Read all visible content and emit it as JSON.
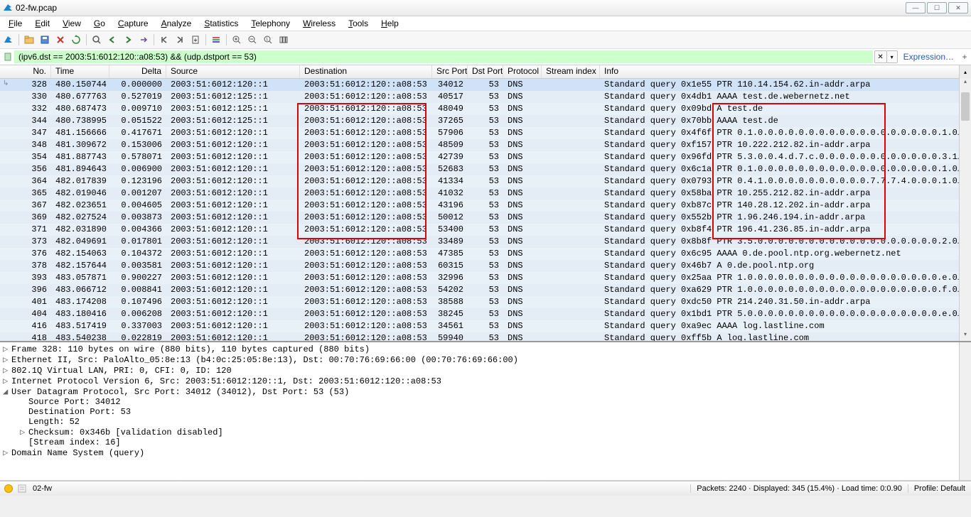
{
  "window": {
    "title": "02-fw.pcap"
  },
  "menu": [
    "File",
    "Edit",
    "View",
    "Go",
    "Capture",
    "Analyze",
    "Statistics",
    "Telephony",
    "Wireless",
    "Tools",
    "Help"
  ],
  "filter": {
    "value": "(ipv6.dst == 2003:51:6012:120::a08:53) && (udp.dstport == 53)",
    "expression_label": "Expression…",
    "plus": "+"
  },
  "columns": [
    "No.",
    "Time",
    "Delta",
    "Source",
    "Destination",
    "Src Port",
    "Dst Port",
    "Protocol",
    "Stream index",
    "Info"
  ],
  "rows": [
    {
      "no": "328",
      "time": "480.150744",
      "delta": "0.000000",
      "src": "2003:51:6012:120::1",
      "dst": "2003:51:6012:120::a08:53",
      "sp": "34012",
      "dp": "53",
      "proto": "DNS",
      "info": "Standard query 0x1e55 PTR 110.14.154.62.in-addr.arpa",
      "sel": true
    },
    {
      "no": "330",
      "time": "480.677763",
      "delta": "0.527019",
      "src": "2003:51:6012:125::1",
      "dst": "2003:51:6012:120::a08:53",
      "sp": "40517",
      "dp": "53",
      "proto": "DNS",
      "info": "Standard query 0x4db1 AAAA test.de.webernetz.net"
    },
    {
      "no": "332",
      "time": "480.687473",
      "delta": "0.009710",
      "src": "2003:51:6012:125::1",
      "dst": "2003:51:6012:120::a08:53",
      "sp": "48049",
      "dp": "53",
      "proto": "DNS",
      "info": "Standard query 0x09bd A test.de"
    },
    {
      "no": "344",
      "time": "480.738995",
      "delta": "0.051522",
      "src": "2003:51:6012:125::1",
      "dst": "2003:51:6012:120::a08:53",
      "sp": "37265",
      "dp": "53",
      "proto": "DNS",
      "info": "Standard query 0x70bb AAAA test.de"
    },
    {
      "no": "347",
      "time": "481.156666",
      "delta": "0.417671",
      "src": "2003:51:6012:120::1",
      "dst": "2003:51:6012:120::a08:53",
      "sp": "57906",
      "dp": "53",
      "proto": "DNS",
      "info": "Standard query 0x4f6f PTR 0.1.0.0.0.0.0.0.0.0.0.0.0.0.0.0.0.0.0.0.1.0…"
    },
    {
      "no": "348",
      "time": "481.309672",
      "delta": "0.153006",
      "src": "2003:51:6012:120::1",
      "dst": "2003:51:6012:120::a08:53",
      "sp": "48509",
      "dp": "53",
      "proto": "DNS",
      "info": "Standard query 0xf157 PTR 10.222.212.82.in-addr.arpa"
    },
    {
      "no": "354",
      "time": "481.887743",
      "delta": "0.578071",
      "src": "2003:51:6012:120::1",
      "dst": "2003:51:6012:120::a08:53",
      "sp": "42739",
      "dp": "53",
      "proto": "DNS",
      "info": "Standard query 0x96fd PTR 5.3.0.0.4.d.7.c.0.0.0.0.0.0.0.0.0.0.0.0.3.1…"
    },
    {
      "no": "356",
      "time": "481.894643",
      "delta": "0.006900",
      "src": "2003:51:6012:120::1",
      "dst": "2003:51:6012:120::a08:53",
      "sp": "52683",
      "dp": "53",
      "proto": "DNS",
      "info": "Standard query 0x6c1a PTR 0.1.0.0.0.0.0.0.0.0.0.0.0.0.0.0.0.0.0.0.1.0…"
    },
    {
      "no": "364",
      "time": "482.017839",
      "delta": "0.123196",
      "src": "2003:51:6012:120::1",
      "dst": "2003:51:6012:120::a08:53",
      "sp": "41334",
      "dp": "53",
      "proto": "DNS",
      "info": "Standard query 0x0793 PTR 0.4.1.0.0.0.0.0.0.0.0.0.0.7.7.7.4.0.0.0.1.0…"
    },
    {
      "no": "365",
      "time": "482.019046",
      "delta": "0.001207",
      "src": "2003:51:6012:120::1",
      "dst": "2003:51:6012:120::a08:53",
      "sp": "41032",
      "dp": "53",
      "proto": "DNS",
      "info": "Standard query 0x58ba PTR 10.255.212.82.in-addr.arpa"
    },
    {
      "no": "367",
      "time": "482.023651",
      "delta": "0.004605",
      "src": "2003:51:6012:120::1",
      "dst": "2003:51:6012:120::a08:53",
      "sp": "43196",
      "dp": "53",
      "proto": "DNS",
      "info": "Standard query 0xb87c PTR 140.28.12.202.in-addr.arpa"
    },
    {
      "no": "369",
      "time": "482.027524",
      "delta": "0.003873",
      "src": "2003:51:6012:120::1",
      "dst": "2003:51:6012:120::a08:53",
      "sp": "50012",
      "dp": "53",
      "proto": "DNS",
      "info": "Standard query 0x552b PTR 1.96.246.194.in-addr.arpa"
    },
    {
      "no": "371",
      "time": "482.031890",
      "delta": "0.004366",
      "src": "2003:51:6012:120::1",
      "dst": "2003:51:6012:120::a08:53",
      "sp": "53400",
      "dp": "53",
      "proto": "DNS",
      "info": "Standard query 0xb8f4 PTR 196.41.236.85.in-addr.arpa"
    },
    {
      "no": "373",
      "time": "482.049691",
      "delta": "0.017801",
      "src": "2003:51:6012:120::1",
      "dst": "2003:51:6012:120::a08:53",
      "sp": "33489",
      "dp": "53",
      "proto": "DNS",
      "info": "Standard query 0x8b8f PTR 3.5.0.0.0.0.0.0.0.0.0.0.0.0.0.0.0.0.0.0.2.0…"
    },
    {
      "no": "376",
      "time": "482.154063",
      "delta": "0.104372",
      "src": "2003:51:6012:120::1",
      "dst": "2003:51:6012:120::a08:53",
      "sp": "47385",
      "dp": "53",
      "proto": "DNS",
      "info": "Standard query 0x6c95 AAAA 0.de.pool.ntp.org.webernetz.net"
    },
    {
      "no": "378",
      "time": "482.157644",
      "delta": "0.003581",
      "src": "2003:51:6012:120::1",
      "dst": "2003:51:6012:120::a08:53",
      "sp": "60315",
      "dp": "53",
      "proto": "DNS",
      "info": "Standard query 0x46b7 A 0.de.pool.ntp.org"
    },
    {
      "no": "393",
      "time": "483.057871",
      "delta": "0.900227",
      "src": "2003:51:6012:120::1",
      "dst": "2003:51:6012:120::a08:53",
      "sp": "32996",
      "dp": "53",
      "proto": "DNS",
      "info": "Standard query 0x25aa PTR 1.0.0.0.0.0.0.0.0.0.0.0.0.0.0.0.0.0.0.0.e.0…"
    },
    {
      "no": "396",
      "time": "483.066712",
      "delta": "0.008841",
      "src": "2003:51:6012:120::1",
      "dst": "2003:51:6012:120::a08:53",
      "sp": "54202",
      "dp": "53",
      "proto": "DNS",
      "info": "Standard query 0xa629 PTR 1.0.0.0.0.0.0.0.0.0.0.0.0.0.0.0.0.0.0.0.f.0…"
    },
    {
      "no": "401",
      "time": "483.174208",
      "delta": "0.107496",
      "src": "2003:51:6012:120::1",
      "dst": "2003:51:6012:120::a08:53",
      "sp": "38588",
      "dp": "53",
      "proto": "DNS",
      "info": "Standard query 0xdc50 PTR 214.240.31.50.in-addr.arpa"
    },
    {
      "no": "404",
      "time": "483.180416",
      "delta": "0.006208",
      "src": "2003:51:6012:120::1",
      "dst": "2003:51:6012:120::a08:53",
      "sp": "38245",
      "dp": "53",
      "proto": "DNS",
      "info": "Standard query 0x1bd1 PTR 5.0.0.0.0.0.0.0.0.0.0.0.0.0.0.0.0.0.0.0.e.0…"
    },
    {
      "no": "416",
      "time": "483.517419",
      "delta": "0.337003",
      "src": "2003:51:6012:120::1",
      "dst": "2003:51:6012:120::a08:53",
      "sp": "34561",
      "dp": "53",
      "proto": "DNS",
      "info": "Standard query 0xa9ec AAAA log.lastline.com"
    },
    {
      "no": "418",
      "time": "483.540238",
      "delta": "0.022819",
      "src": "2003:51:6012:120::1",
      "dst": "2003:51:6012:120::a08:53",
      "sp": "59940",
      "dp": "53",
      "proto": "DNS",
      "info": "Standard query 0xff5b A log.lastline.com"
    }
  ],
  "details": [
    {
      "tri": "▷",
      "ind": 0,
      "text": "Frame 328: 110 bytes on wire (880 bits), 110 bytes captured (880 bits)"
    },
    {
      "tri": "▷",
      "ind": 0,
      "text": "Ethernet II, Src: PaloAlto_05:8e:13 (b4:0c:25:05:8e:13), Dst: 00:70:76:69:66:00 (00:70:76:69:66:00)"
    },
    {
      "tri": "▷",
      "ind": 0,
      "text": "802.1Q Virtual LAN, PRI: 0, CFI: 0, ID: 120"
    },
    {
      "tri": "▷",
      "ind": 0,
      "text": "Internet Protocol Version 6, Src: 2003:51:6012:120::1, Dst: 2003:51:6012:120::a08:53"
    },
    {
      "tri": "◢",
      "ind": 0,
      "text": "User Datagram Protocol, Src Port: 34012 (34012), Dst Port: 53 (53)"
    },
    {
      "tri": "",
      "ind": 1,
      "text": "Source Port: 34012"
    },
    {
      "tri": "",
      "ind": 1,
      "text": "Destination Port: 53"
    },
    {
      "tri": "",
      "ind": 1,
      "text": "Length: 52"
    },
    {
      "tri": "▷",
      "ind": 1,
      "text": "Checksum: 0x346b [validation disabled]"
    },
    {
      "tri": "",
      "ind": 1,
      "text": "[Stream index: 16]"
    },
    {
      "tri": "▷",
      "ind": 0,
      "text": "Domain Name System (query)"
    }
  ],
  "status": {
    "file": "02-fw",
    "stats": "Packets: 2240 · Displayed: 345 (15.4%) · Load time: 0:0.90",
    "profile": "Profile: Default"
  }
}
